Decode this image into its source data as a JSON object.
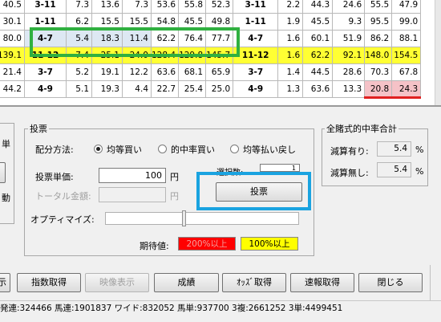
{
  "table": {
    "rows": [
      {
        "style": "normal",
        "cells": [
          "40.5",
          "3-11",
          "7.3",
          "13.6",
          "7.3",
          "53.6",
          "55.8",
          "52.3",
          "3-11",
          "2.2",
          "44.3",
          "24.6",
          "55.5",
          "47.9"
        ]
      },
      {
        "style": "normal",
        "cells": [
          "30.1",
          "1-11",
          "6.2",
          "15.5",
          "15.5",
          "54.8",
          "45.5",
          "49.8",
          "1-11",
          "1.9",
          "45.5",
          "9.3",
          "95.5",
          "99.0"
        ]
      },
      {
        "style": "selected",
        "cells": [
          "80.0",
          "4-7",
          "5.4",
          "18.3",
          "11.4",
          "62.2",
          "76.4",
          "77.7",
          "4-7",
          "1.6",
          "60.1",
          "51.9",
          "86.2",
          "88.1"
        ]
      },
      {
        "style": "yellow",
        "cells": [
          "139.1",
          "11-12",
          "7.4",
          "25.1",
          "24.0",
          "128.4",
          "129.8",
          "145.7",
          "11-12",
          "1.6",
          "62.2",
          "92.1",
          "148.0",
          "154.5"
        ]
      },
      {
        "style": "normal",
        "cells": [
          "21.4",
          "3-7",
          "5.2",
          "19.1",
          "12.2",
          "63.6",
          "68.1",
          "65.9",
          "3-7",
          "1.4",
          "44.5",
          "28.6",
          "70.3",
          "67.8"
        ]
      },
      {
        "style": "normal",
        "cells": [
          "44.2",
          "4-9",
          "5.1",
          "19.3",
          "4.4",
          "22.7",
          "25.4",
          "25.0",
          "4-9",
          "1.3",
          "63.6",
          "13.3",
          "20.8",
          "24.3"
        ]
      }
    ]
  },
  "vote": {
    "group_title": "投票",
    "method_label": "配分方法:",
    "methods": [
      {
        "label": "均等買い",
        "selected": true
      },
      {
        "label": "的中率買い",
        "selected": false
      },
      {
        "label": "均等払い戻し",
        "selected": false
      }
    ],
    "unit_price_label": "投票単価:",
    "unit_price_value": "100",
    "unit_price_suffix": "円",
    "total_label": "トータル金額:",
    "total_value": "",
    "total_suffix": "円",
    "selected_count_label": "選択数:",
    "selected_count_value": "1",
    "vote_button": "投票",
    "optimize_label": "オプティマイズ:",
    "optimize_level": 0.41,
    "expected_label": "期待値:",
    "legend_red": "200%以上",
    "legend_yellow": "100%以上",
    "left_chars": [
      "単",
      "動"
    ]
  },
  "total_hit": {
    "group_title": "全賭式的中率合計",
    "reduced_label": "減算有り:",
    "reduced_value": "5.4",
    "unreduced_label": "減算無し:",
    "unreduced_value": "5.4",
    "unit": "%"
  },
  "buttons": {
    "show": "示",
    "index": "指数取得",
    "video": "映像表示",
    "result": "成績",
    "odds": "ｵｯｽﾞ取得",
    "flash": "速報取得",
    "close": "閉じる"
  },
  "status_bar": "発連:324466 馬連:1901837 ワイド:832052 馬単:937700 3複:2661252 3単:4499451",
  "colors": {
    "highlight_green": "#30b040",
    "highlight_blue": "#1aa3e0",
    "row_yellow": "#ffff33",
    "legend_red": "#ff0000",
    "legend_yellow": "#ffff00"
  }
}
